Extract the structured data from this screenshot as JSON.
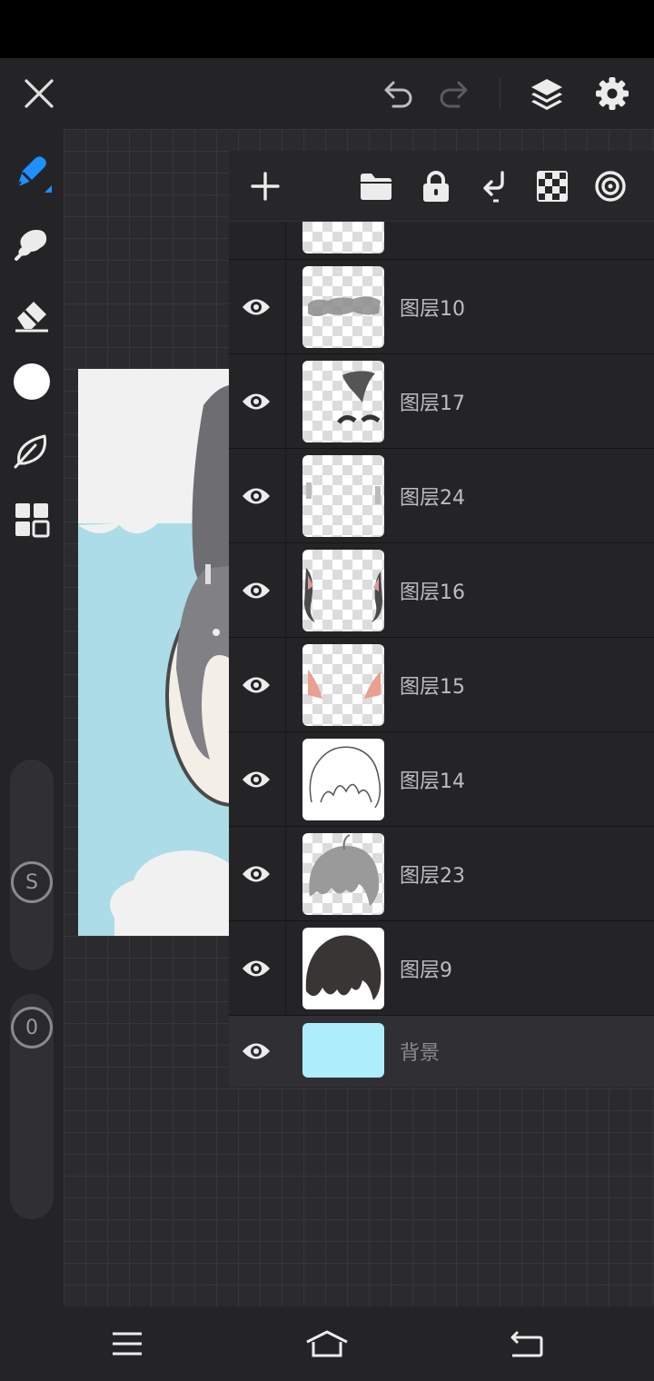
{
  "app": {
    "accent_color": "#1e90ff",
    "background_color": "#242427"
  },
  "toolbar": {
    "close_icon": "close-icon",
    "undo_icon": "undo-icon",
    "redo_icon": "redo-icon",
    "layers_icon": "layers-icon",
    "settings_icon": "gear-icon"
  },
  "tools": [
    {
      "name": "pen",
      "icon": "pen-icon",
      "active": true
    },
    {
      "name": "smudge",
      "icon": "smudge-icon"
    },
    {
      "name": "eraser",
      "icon": "eraser-icon"
    },
    {
      "name": "color",
      "icon": "color-swatch",
      "color": "#ffffff"
    },
    {
      "name": "leaf",
      "icon": "leaf-icon"
    },
    {
      "name": "grid",
      "icon": "grid-icon"
    }
  ],
  "sliders": {
    "size_label": "S",
    "opacity_label": "0"
  },
  "layer_panel": {
    "actions": [
      "add-layer-icon",
      "folder-icon",
      "lock-icon",
      "merge-down-icon",
      "transparency-icon",
      "target-icon"
    ],
    "layers": [
      {
        "name": "",
        "visible": true
      },
      {
        "name": "图层10",
        "visible": true
      },
      {
        "name": "图层17",
        "visible": true
      },
      {
        "name": "图层24",
        "visible": true
      },
      {
        "name": "图层16",
        "visible": true
      },
      {
        "name": "图层15",
        "visible": true
      },
      {
        "name": "图层14",
        "visible": true
      },
      {
        "name": "图层23",
        "visible": true
      },
      {
        "name": "图层9",
        "visible": true
      },
      {
        "name": "背景",
        "visible": true,
        "selected": true,
        "color": "#aeeefc"
      }
    ]
  },
  "nav": {
    "menu_icon": "menu-icon",
    "home_icon": "home-icon",
    "back_icon": "back-icon"
  }
}
